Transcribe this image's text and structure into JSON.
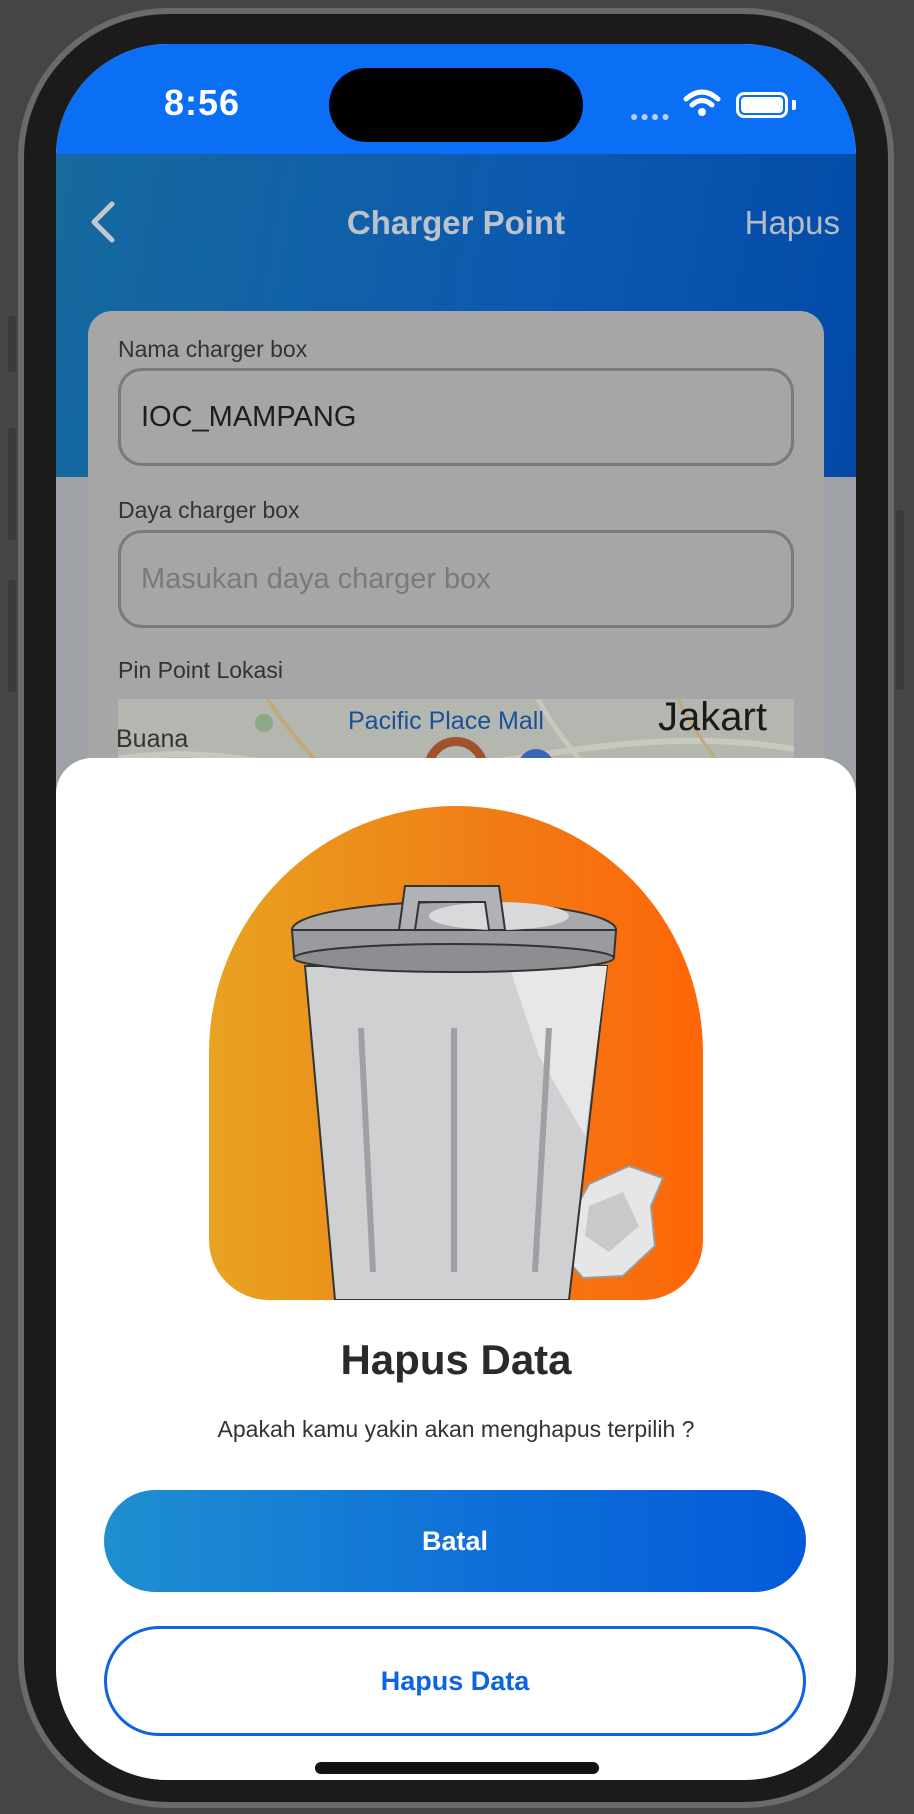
{
  "status_bar": {
    "time": "8:56",
    "signal_icon": "cellular-dots-icon",
    "wifi_icon": "wifi-icon",
    "battery_icon": "battery-icon"
  },
  "header": {
    "back_icon": "chevron-left-icon",
    "title": "Charger Point",
    "action_label": "Hapus"
  },
  "form": {
    "name_label": "Nama charger box",
    "name_value": "IOC_MAMPANG",
    "power_label": "Daya charger box",
    "power_placeholder": "Masukan daya charger box",
    "location_label": "Pin Point Lokasi"
  },
  "map": {
    "labels": [
      "Buana",
      "Pacific Place Mall",
      "Jakart"
    ]
  },
  "dialog": {
    "illustration": "trash-can-icon",
    "title": "Hapus Data",
    "description": "Apakah kamu yakin akan menghapus terpilih ?",
    "cancel_label": "Batal",
    "confirm_label": "Hapus Data"
  },
  "colors": {
    "primary_blue": "#0b6ff5",
    "button_blue": "#0c63e4",
    "illustration_orange": "#f17a15"
  }
}
